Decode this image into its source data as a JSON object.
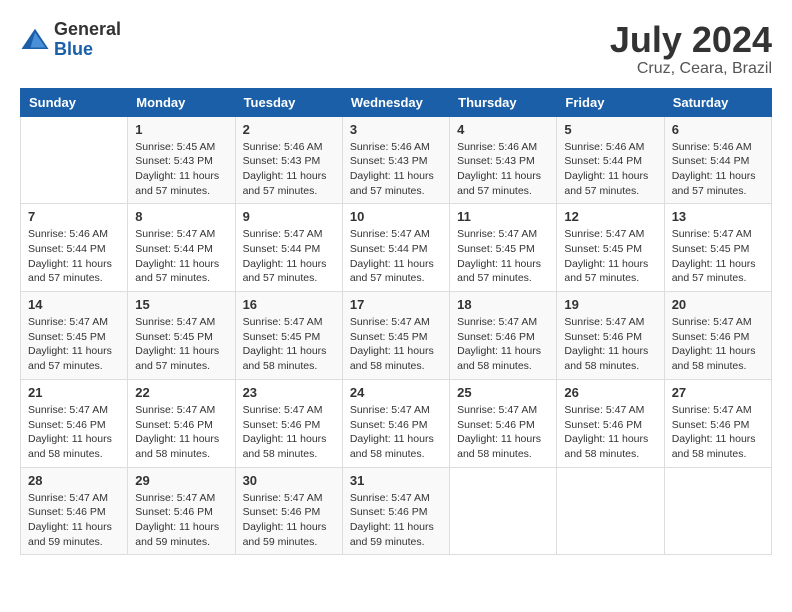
{
  "header": {
    "logo_general": "General",
    "logo_blue": "Blue",
    "month_title": "July 2024",
    "location": "Cruz, Ceara, Brazil"
  },
  "weekdays": [
    "Sunday",
    "Monday",
    "Tuesday",
    "Wednesday",
    "Thursday",
    "Friday",
    "Saturday"
  ],
  "weeks": [
    [
      {
        "day": "",
        "info": ""
      },
      {
        "day": "1",
        "info": "Sunrise: 5:45 AM\nSunset: 5:43 PM\nDaylight: 11 hours\nand 57 minutes."
      },
      {
        "day": "2",
        "info": "Sunrise: 5:46 AM\nSunset: 5:43 PM\nDaylight: 11 hours\nand 57 minutes."
      },
      {
        "day": "3",
        "info": "Sunrise: 5:46 AM\nSunset: 5:43 PM\nDaylight: 11 hours\nand 57 minutes."
      },
      {
        "day": "4",
        "info": "Sunrise: 5:46 AM\nSunset: 5:43 PM\nDaylight: 11 hours\nand 57 minutes."
      },
      {
        "day": "5",
        "info": "Sunrise: 5:46 AM\nSunset: 5:44 PM\nDaylight: 11 hours\nand 57 minutes."
      },
      {
        "day": "6",
        "info": "Sunrise: 5:46 AM\nSunset: 5:44 PM\nDaylight: 11 hours\nand 57 minutes."
      }
    ],
    [
      {
        "day": "7",
        "info": "Sunrise: 5:46 AM\nSunset: 5:44 PM\nDaylight: 11 hours\nand 57 minutes."
      },
      {
        "day": "8",
        "info": "Sunrise: 5:47 AM\nSunset: 5:44 PM\nDaylight: 11 hours\nand 57 minutes."
      },
      {
        "day": "9",
        "info": "Sunrise: 5:47 AM\nSunset: 5:44 PM\nDaylight: 11 hours\nand 57 minutes."
      },
      {
        "day": "10",
        "info": "Sunrise: 5:47 AM\nSunset: 5:44 PM\nDaylight: 11 hours\nand 57 minutes."
      },
      {
        "day": "11",
        "info": "Sunrise: 5:47 AM\nSunset: 5:45 PM\nDaylight: 11 hours\nand 57 minutes."
      },
      {
        "day": "12",
        "info": "Sunrise: 5:47 AM\nSunset: 5:45 PM\nDaylight: 11 hours\nand 57 minutes."
      },
      {
        "day": "13",
        "info": "Sunrise: 5:47 AM\nSunset: 5:45 PM\nDaylight: 11 hours\nand 57 minutes."
      }
    ],
    [
      {
        "day": "14",
        "info": "Sunrise: 5:47 AM\nSunset: 5:45 PM\nDaylight: 11 hours\nand 57 minutes."
      },
      {
        "day": "15",
        "info": "Sunrise: 5:47 AM\nSunset: 5:45 PM\nDaylight: 11 hours\nand 57 minutes."
      },
      {
        "day": "16",
        "info": "Sunrise: 5:47 AM\nSunset: 5:45 PM\nDaylight: 11 hours\nand 58 minutes."
      },
      {
        "day": "17",
        "info": "Sunrise: 5:47 AM\nSunset: 5:45 PM\nDaylight: 11 hours\nand 58 minutes."
      },
      {
        "day": "18",
        "info": "Sunrise: 5:47 AM\nSunset: 5:46 PM\nDaylight: 11 hours\nand 58 minutes."
      },
      {
        "day": "19",
        "info": "Sunrise: 5:47 AM\nSunset: 5:46 PM\nDaylight: 11 hours\nand 58 minutes."
      },
      {
        "day": "20",
        "info": "Sunrise: 5:47 AM\nSunset: 5:46 PM\nDaylight: 11 hours\nand 58 minutes."
      }
    ],
    [
      {
        "day": "21",
        "info": "Sunrise: 5:47 AM\nSunset: 5:46 PM\nDaylight: 11 hours\nand 58 minutes."
      },
      {
        "day": "22",
        "info": "Sunrise: 5:47 AM\nSunset: 5:46 PM\nDaylight: 11 hours\nand 58 minutes."
      },
      {
        "day": "23",
        "info": "Sunrise: 5:47 AM\nSunset: 5:46 PM\nDaylight: 11 hours\nand 58 minutes."
      },
      {
        "day": "24",
        "info": "Sunrise: 5:47 AM\nSunset: 5:46 PM\nDaylight: 11 hours\nand 58 minutes."
      },
      {
        "day": "25",
        "info": "Sunrise: 5:47 AM\nSunset: 5:46 PM\nDaylight: 11 hours\nand 58 minutes."
      },
      {
        "day": "26",
        "info": "Sunrise: 5:47 AM\nSunset: 5:46 PM\nDaylight: 11 hours\nand 58 minutes."
      },
      {
        "day": "27",
        "info": "Sunrise: 5:47 AM\nSunset: 5:46 PM\nDaylight: 11 hours\nand 58 minutes."
      }
    ],
    [
      {
        "day": "28",
        "info": "Sunrise: 5:47 AM\nSunset: 5:46 PM\nDaylight: 11 hours\nand 59 minutes."
      },
      {
        "day": "29",
        "info": "Sunrise: 5:47 AM\nSunset: 5:46 PM\nDaylight: 11 hours\nand 59 minutes."
      },
      {
        "day": "30",
        "info": "Sunrise: 5:47 AM\nSunset: 5:46 PM\nDaylight: 11 hours\nand 59 minutes."
      },
      {
        "day": "31",
        "info": "Sunrise: 5:47 AM\nSunset: 5:46 PM\nDaylight: 11 hours\nand 59 minutes."
      },
      {
        "day": "",
        "info": ""
      },
      {
        "day": "",
        "info": ""
      },
      {
        "day": "",
        "info": ""
      }
    ]
  ]
}
